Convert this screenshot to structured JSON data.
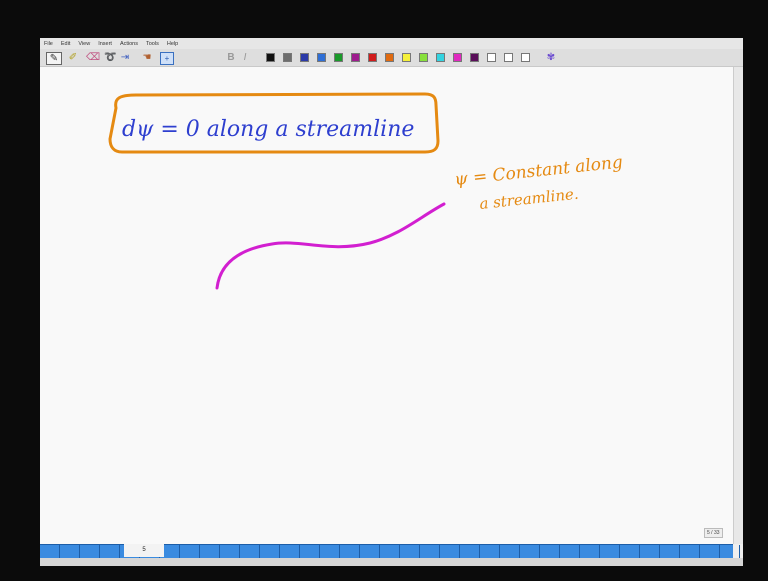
{
  "menu": [
    "File",
    "Edit",
    "View",
    "Insert",
    "Actions",
    "Tools",
    "Help"
  ],
  "toolbar": {
    "icons": [
      "pen-tool-icon",
      "highlighter-icon",
      "eraser-icon",
      "lasso-icon",
      "insert-space-icon",
      "add-page-icon"
    ],
    "format_icons": [
      "bold-icon",
      "italic-icon"
    ],
    "colors": [
      "#111111",
      "#6d6d6d",
      "#2b3aa8",
      "#2f6fd6",
      "#1a9a2a",
      "#9e1c8e",
      "#d01c1c",
      "#e06a10",
      "#f5f03a",
      "#88e03c",
      "#34d3e0",
      "#e02ac0",
      "#5a0f5a",
      "#ffffff",
      "#ffffff",
      "#ffffff"
    ]
  },
  "ink": {
    "box_text": "dψ = 0   along  a  streamline",
    "note_line1": "ψ = Constant  along",
    "note_line2": "a  streamline.",
    "colors": {
      "blue": "#2e3fcf",
      "orange": "#e58a12",
      "magenta": "#d21fd0"
    }
  },
  "status": {
    "page_counter": "5 / 33",
    "current_page": "5"
  }
}
